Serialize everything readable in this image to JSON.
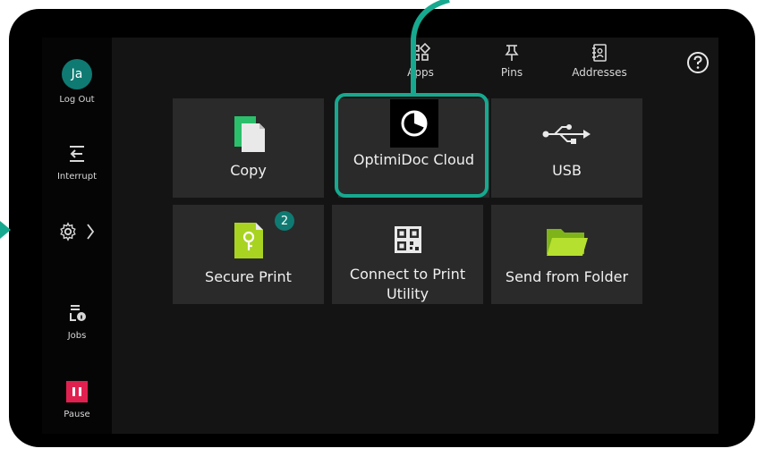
{
  "sidebar": {
    "user": {
      "initials": "Ja",
      "label": "Log Out"
    },
    "interrupt": {
      "label": "Interrupt"
    },
    "settings": {
      "icon": "gear-icon"
    },
    "jobs": {
      "label": "Jobs"
    },
    "pause": {
      "label": "Pause"
    }
  },
  "topbar": {
    "tabs": [
      {
        "label": "Apps",
        "icon": "apps-icon"
      },
      {
        "label": "Pins",
        "icon": "pin-icon"
      },
      {
        "label": "Addresses",
        "icon": "address-book-icon"
      }
    ],
    "help_icon": "help-icon"
  },
  "tiles": [
    {
      "label": "Copy",
      "icon": "copy-icon"
    },
    {
      "label": "OptimiDoc Cloud",
      "icon": "optimidoc-icon"
    },
    {
      "label": "USB",
      "icon": "usb-icon"
    },
    {
      "label": "Secure Print",
      "icon": "secure-print-icon",
      "badge": "2"
    },
    {
      "label": "Connect to Print Utility",
      "icon": "qr-code-icon"
    },
    {
      "label": "Send from Folder",
      "icon": "folder-icon"
    }
  ],
  "colors": {
    "accent": "#17a98f",
    "avatar": "#0f7a72",
    "pause": "#e0214f",
    "tile": "#2a2a2a",
    "background": "#141414"
  }
}
